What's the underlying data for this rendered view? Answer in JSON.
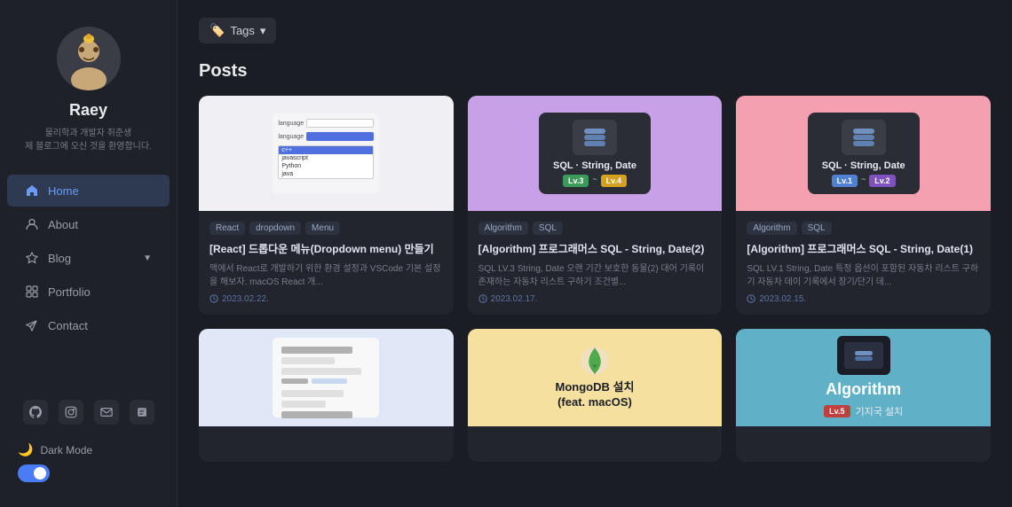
{
  "sidebar": {
    "username": "Raey",
    "bio_line1": "물리학과 개발자 취준생",
    "bio_line2": "제 블로그에 오신 것을 환영합니다.",
    "nav": [
      {
        "id": "home",
        "label": "Home",
        "icon": "home",
        "active": true
      },
      {
        "id": "about",
        "label": "About",
        "icon": "user",
        "active": false
      },
      {
        "id": "blog",
        "label": "Blog",
        "icon": "star",
        "active": false,
        "has_chevron": true
      },
      {
        "id": "portfolio",
        "label": "Portfolio",
        "icon": "grid",
        "active": false
      },
      {
        "id": "contact",
        "label": "Contact",
        "icon": "send",
        "active": false
      }
    ],
    "social_icons": [
      "github",
      "instagram",
      "email",
      "notion"
    ],
    "dark_mode_label": "Dark Mode",
    "dark_mode_enabled": true
  },
  "header": {
    "tags_label": "Tags"
  },
  "posts_section": {
    "title": "Posts",
    "cards": [
      {
        "id": "card1",
        "thumb_type": "dropdown_preview",
        "tags": [
          "React",
          "dropdown",
          "Menu"
        ],
        "title": "[React] 드롭다운 메뉴(Dropdown menu) 만들기",
        "excerpt": "맥에서 React로 개발하기 위한 환경 설정과 VSCode 기본 설정을 해보자. macOS React 개...",
        "date": "2023.02.22."
      },
      {
        "id": "card2",
        "thumb_type": "sql_purple",
        "thumb_title": "SQL · String, Date",
        "badges": [
          "Lv.3 ~ Lv.4"
        ],
        "tags": [
          "Algorithm",
          "SQL"
        ],
        "title": "[Algorithm] 프로그래머스 SQL - String, Date(2)",
        "excerpt": "SQL LV.3 String, Date 오랜 기간 보호한 동물(2) 대어 기록이 존재하는 자동차 리스트 구하기 조건별...",
        "date": "2023.02.17."
      },
      {
        "id": "card3",
        "thumb_type": "sql_pink",
        "thumb_title": "SQL · String, Date",
        "badges": [
          "Lv.1 ~ Lv.2"
        ],
        "tags": [
          "Algorithm",
          "SQL"
        ],
        "title": "[Algorithm] 프로그래머스 SQL - String, Date(1)",
        "excerpt": "SQL LV.1 String, Date 특정 옵션이 포함된 자동차 리스트 구하기 자동차 데이 기록에서 장기/단기 데...",
        "date": "2023.02.15."
      },
      {
        "id": "card4",
        "thumb_type": "sql_note",
        "tags": [],
        "title": "",
        "excerpt": "",
        "date": ""
      },
      {
        "id": "card5",
        "thumb_type": "mongodb",
        "thumb_title": "MongoDB 설치\n(feat. macOS)",
        "tags": [],
        "title": "",
        "excerpt": "",
        "date": ""
      },
      {
        "id": "card6",
        "thumb_type": "algorithm",
        "thumb_title": "Algorithm",
        "badges": [
          "Lv.5"
        ],
        "thumb_sub": "기지국 설치",
        "tags": [],
        "title": "",
        "excerpt": "",
        "date": ""
      }
    ]
  }
}
